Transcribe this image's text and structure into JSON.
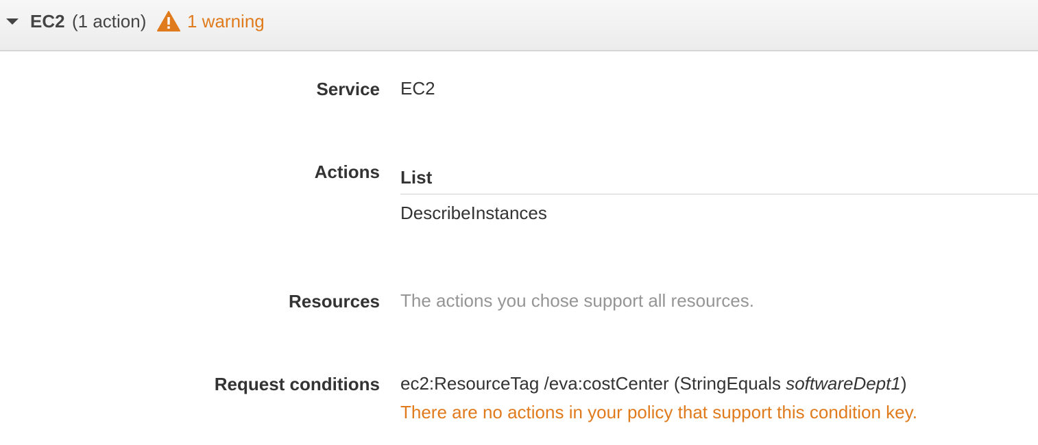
{
  "header": {
    "title": "EC2",
    "count": "(1 action)",
    "warning": "1 warning",
    "icons": [
      "caret-down-icon",
      "warning-icon"
    ],
    "colors": {
      "warning": "#e07b1d",
      "header_bg": "#ececec"
    }
  },
  "rows": {
    "service": {
      "label": "Service",
      "value": "EC2"
    },
    "actions": {
      "label": "Actions",
      "group": "List",
      "value": "DescribeInstances"
    },
    "resources": {
      "label": "Resources",
      "value": "The actions you chose support all resources."
    },
    "conditions": {
      "label": "Request conditions",
      "key": "ec2:ResourceTag /eva:costCenter (StringEquals ",
      "value": "softwareDept1",
      "close": ")",
      "warning": "There are no actions in your policy that support this condition key."
    }
  }
}
